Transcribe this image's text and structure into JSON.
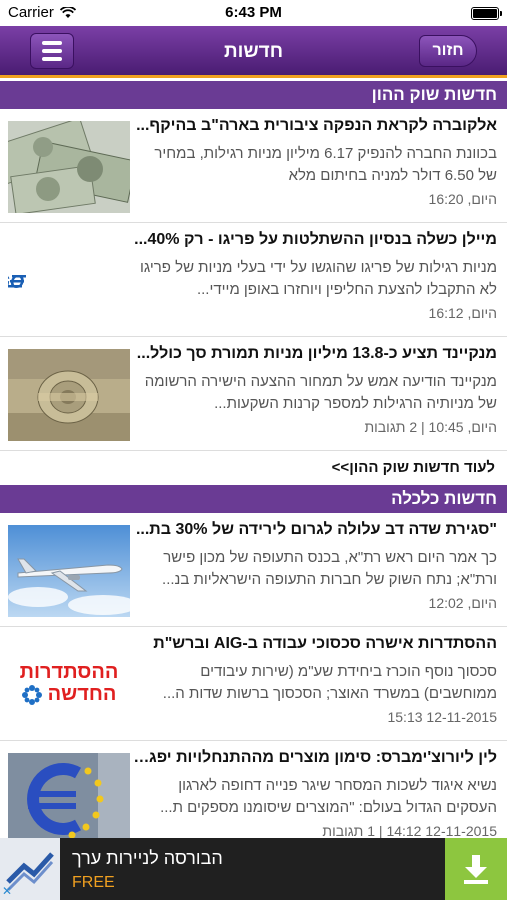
{
  "status": {
    "carrier": "Carrier",
    "time": "6:43 PM",
    "battery_level": 1.0
  },
  "nav": {
    "title": "חדשות",
    "back_label": "חזור",
    "menu_icon": "hamburger-menu-icon"
  },
  "sections": [
    {
      "title": "חדשות שוק ההון",
      "articles": [
        {
          "title": "אלקוברה לקראת הנפקה ציבורית בארה\"ב בהיקף...",
          "summary": "בכוונת החברה להנפיק 6.17 מיליון מניות רגילות, במחיר של 6.50 דולר למניה בחיתום מלא",
          "meta": "היום, 16:20",
          "image": "dollar-bills-thumbnail"
        },
        {
          "title": "מיילן כשלה בנסיון ההשתלטות על פריגו - רק 40%...",
          "summary": "מניות רגילות של פריגו שהוגשו על ידי בעלי מניות של פריגו לא התקבלו להצעת החליפין ויוחזרו באופן מיידי...",
          "meta": "היום, 16:12",
          "image": "perrigo-logo",
          "logo_text": "PERRIGO"
        },
        {
          "title": "מנקיינד תציע כ-13.8 מיליון מניות תמורת סך כולל...",
          "summary": "מנקיינד הודיעה אמש על תמחור ההצעה הישירה הרשומה של מניותיה הרגילות למספר קרנות השקעות...",
          "meta": "היום, 10:45 | 2 תגובות",
          "image": "rolled-money-thumbnail"
        }
      ],
      "more_label": "לעוד חדשות שוק ההון>>"
    },
    {
      "title": "חדשות כלכלה",
      "articles": [
        {
          "title": "\"סגירת שדה דב עלולה לגרום לירידה של 30% בת...",
          "summary": "כך אמר היום ראש רת\"א, בכנס התעופה של מכון פישר ורת\"א; נתח השוק של חברות התעופה הישראליות בנ...",
          "meta": "היום, 12:02",
          "image": "airplane-thumbnail"
        },
        {
          "title": "ההסתדרות אישרה סכסוכי עבודה ב-AIG וברש\"ת",
          "summary": "סכסוך נוסף הוכרז ביחידת שע\"מ (שירות עיבודים ממוחשבים) במשרד האוצר; הסכסוך ברשות שדות ה...",
          "meta": "12-11-2015 15:13",
          "image": "histadrut-logo",
          "logo_text_line1": "ההסתדרות",
          "logo_text_line2": "החדשה"
        },
        {
          "title": "לין ליורוצ'ימברס: סימון מוצרים מההתנחלויות יפגע...",
          "summary": "נשיא איגוד לשכות המסחר שיגר פנייה דחופה לארגון העסקים הגדול בעולם: \"המוצרים שיסומנו מספקים ת...",
          "meta": "12-11-2015 14:12 | 1 תגובות",
          "image": "euro-sign-thumbnail"
        }
      ]
    }
  ],
  "ad": {
    "title": "הבורסה לניירות ערך",
    "free_label": "FREE",
    "download_icon": "download-arrow-icon",
    "close_icon": "close-x-icon",
    "close_glyph": "✕"
  },
  "colors": {
    "nav_purple": "#5a2786",
    "section_purple": "#6a3b94",
    "accent_orange": "#f0a020",
    "ad_green": "#8dc63f"
  }
}
